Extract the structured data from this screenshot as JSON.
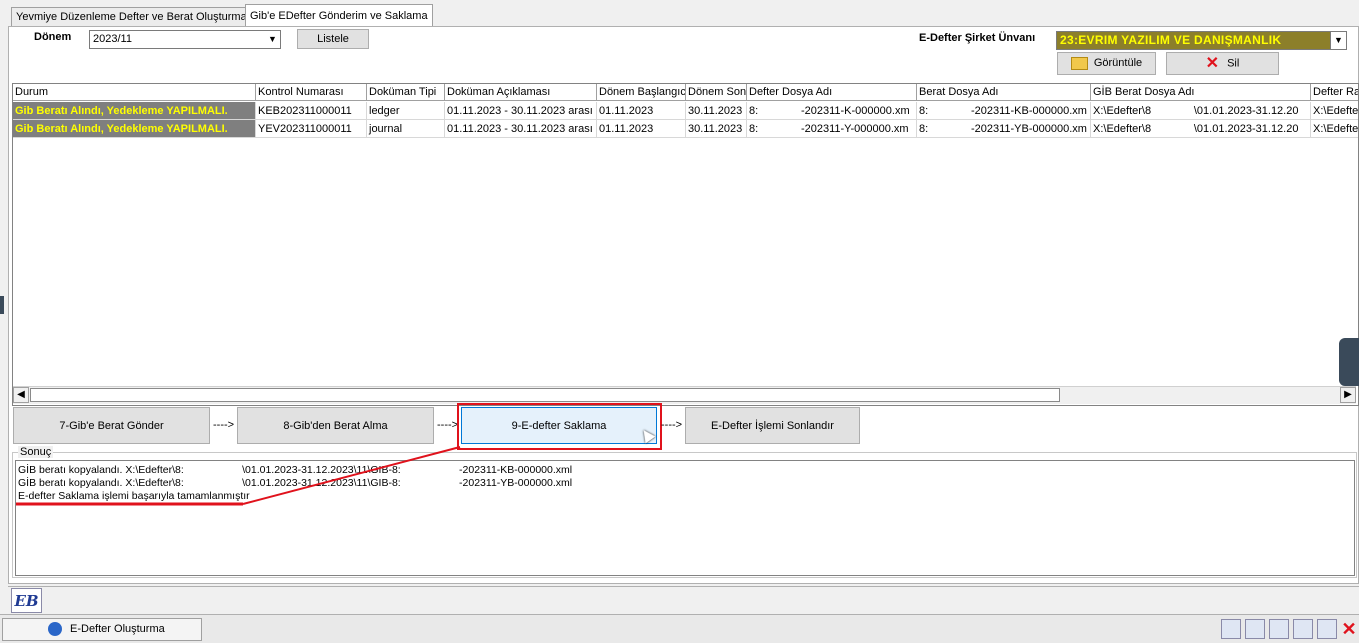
{
  "tabs": [
    {
      "label": "Yevmiye Düzenleme  Defter ve Berat Oluşturma",
      "active": false
    },
    {
      "label": "Gib'e EDefter Gönderim ve Saklama",
      "active": true
    }
  ],
  "period": {
    "label": "Dönem",
    "value": "2023/11"
  },
  "list_button": "Listele",
  "company": {
    "label": "E-Defter Şirket Ünvanı",
    "value": "23:EVRIM YAZILIM VE DANIŞMANLIK"
  },
  "view_button": "Görüntüle",
  "delete_button": "Sil",
  "grid": {
    "columns": [
      "Durum",
      "Kontrol Numarası",
      "Doküman Tipi",
      "Doküman Açıklaması",
      "Dönem Başlangıcı",
      "Dönem Son",
      "Defter Dosya Adı",
      "Berat Dosya Adı",
      "GİB Berat Dosya Adı",
      "Defter Ra"
    ],
    "rows": [
      [
        "Gib Beratı Alındı, Yedekleme YAPILMALI.",
        "KEB202311000011",
        "ledger",
        "01.11.2023 - 30.11.2023 arası ",
        "01.11.2023",
        "30.11.2023",
        "8:              -202311-K-000000.xm",
        "8:              -202311-KB-000000.xm",
        "X:\\Edefter\\8              \\01.01.2023-31.12.20",
        "X:\\Edefte"
      ],
      [
        "Gib Beratı Alındı, Yedekleme YAPILMALI.",
        "YEV202311000011",
        "journal",
        "01.11.2023 - 30.11.2023 arası ",
        "01.11.2023",
        "30.11.2023",
        "8:              -202311-Y-000000.xm",
        "8:              -202311-YB-000000.xm",
        "X:\\Edefter\\8              \\01.01.2023-31.12.20",
        "X:\\Edefte"
      ]
    ]
  },
  "steps": {
    "step7": "7-Gib'e Berat Gönder",
    "step8": "8-Gib'den Berat Alma",
    "step9": "9-E-defter Saklama",
    "finish": "E-Defter İşlemi Sonlandır",
    "arrow": "---->"
  },
  "result": {
    "label": "Sonuç",
    "lines": [
      "GİB beratı kopyalandı. X:\\Edefter\\8:                    \\01.01.2023-31.12.2023\\11\\GIB-8:                    -202311-KB-000000.xml",
      "GİB beratı kopyalandı. X:\\Edefter\\8:                    \\01.01.2023-31.12.2023\\11\\GIB-8:                    -202311-YB-000000.xml",
      "E-defter Saklama işlemi başarıyla tamamlanmıştır"
    ]
  },
  "taskbar": {
    "item": "E-Defter Oluşturma",
    "logo_text": "EB"
  },
  "colors": {
    "highlight_red": "#e0121c",
    "status_bg": "#7f7f7f",
    "status_fg": "#ffff00",
    "company_bg": "#8c7f2a",
    "company_fg": "#ffff00"
  }
}
